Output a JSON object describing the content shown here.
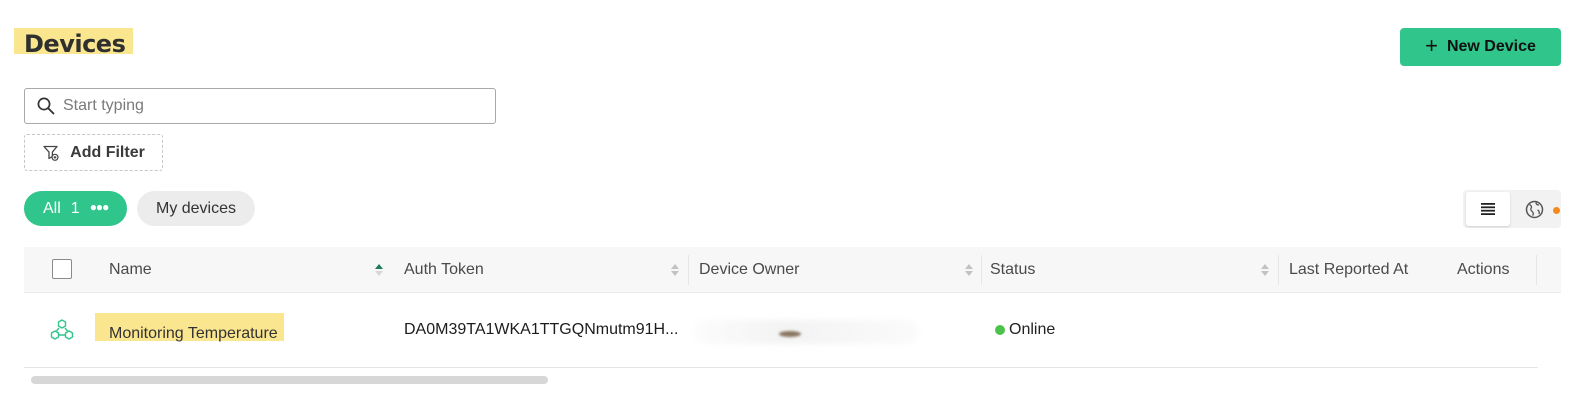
{
  "page": {
    "title": "Devices"
  },
  "toolbar": {
    "new_device_label": "New Device",
    "new_device_icon": "plus-icon"
  },
  "search": {
    "placeholder": "Start typing",
    "value": ""
  },
  "filter": {
    "add_filter_label": "Add Filter"
  },
  "chips": {
    "all_label": "All",
    "all_count": "1",
    "my_devices_label": "My devices"
  },
  "table": {
    "columns": [
      "Name",
      "Auth Token",
      "Device Owner",
      "Status",
      "Last Reported At",
      "Actions"
    ],
    "rows": [
      {
        "name": "Monitoring Temperature",
        "auth_token": "DA0M39TA1WKA1TTGQNmutm91H...",
        "device_owner": "",
        "status": "Online",
        "last_reported_at": "",
        "actions": ""
      }
    ]
  },
  "colors": {
    "accent": "#2fc58b",
    "highlight": "#fbe690",
    "status_online": "#4cc24a",
    "map_notification": "#f28a1c"
  }
}
